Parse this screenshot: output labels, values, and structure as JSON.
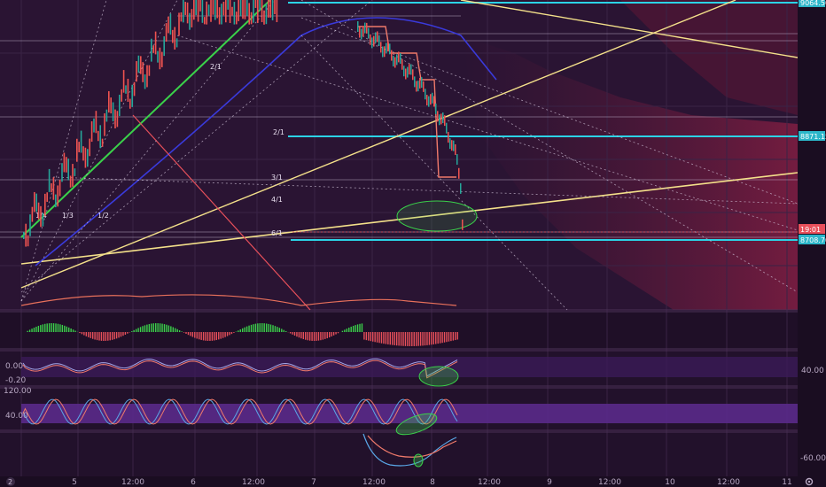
{
  "chart_data": {
    "type": "line",
    "panels": [
      {
        "name": "price"
      },
      {
        "name": "histogram"
      },
      {
        "name": "oscillator-1"
      },
      {
        "name": "oscillator-2"
      },
      {
        "name": "oscillator-3"
      }
    ],
    "time_ticks": [
      "5",
      "12:00",
      "6",
      "12:00",
      "7",
      "12:00",
      "8",
      "12:00",
      "9",
      "12:00",
      "10",
      "12:00",
      "11"
    ],
    "price_labels": [
      {
        "text": "9064.50",
        "color": "#2bb6c9"
      },
      {
        "text": "8871.15",
        "color": "#2bb6c9"
      },
      {
        "text": "19:01",
        "color": "#e8505b"
      },
      {
        "text": "8708.70",
        "color": "#2bb6c9"
      }
    ],
    "gann_labels": [
      "2/1",
      "2/1",
      "3/1",
      "4/1",
      "6/1",
      "1/4",
      "1/3",
      "1/2"
    ],
    "osc1": {
      "ticks_left": [
        "0.00",
        "-0.20"
      ],
      "ticks_right": [
        "40.00"
      ]
    },
    "osc2": {
      "ticks_left": [
        "120.00",
        "40.00"
      ]
    },
    "osc3": {
      "ticks_right": [
        "-60.00"
      ]
    },
    "levels": {
      "top": 9064.5,
      "mid": 8871.15,
      "low": 8708.7
    },
    "colors": {
      "cyan": "#2bd3e6",
      "yellow": "#f4e08a",
      "green": "#3ad14a",
      "red": "#e8505b",
      "background": "#22112b"
    },
    "price_series_approx": [
      9000,
      9020,
      9050,
      9060,
      9070,
      9075,
      9080,
      9064,
      8880,
      8850,
      8760,
      8740,
      8720,
      8715,
      8712,
      8709
    ]
  },
  "footer": {
    "badge": "2",
    "settings_icon": "gear-icon"
  }
}
